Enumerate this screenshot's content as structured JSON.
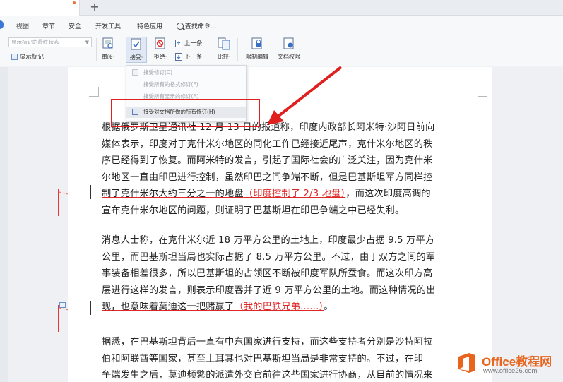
{
  "tabs": {
    "add_label": "+"
  },
  "ribbon": {
    "items": [
      "视图",
      "章节",
      "安全",
      "开发工具",
      "特色应用"
    ],
    "search_label": "查找命令..."
  },
  "toolbar": {
    "markup_select": {
      "value": "显示标记的最终状态"
    },
    "show_markup_label": "显示标记",
    "review_label": "审阅·",
    "accept_label": "接受·",
    "reject_label": "拒绝·",
    "prev_label": "上一条",
    "next_label": "下一条",
    "compare_label": "比较·",
    "restrict_label": "限制编辑",
    "permission_label": "文档权限"
  },
  "dropdown": {
    "items": [
      {
        "label": "接受修订(C)",
        "enabled": false
      },
      {
        "label": "接受所有的格式修订(F)",
        "enabled": false
      },
      {
        "label": "接受所有显示的修订(A)",
        "enabled": false
      },
      {
        "label": "接受对文档所做的所有修订(H)",
        "enabled": true
      }
    ]
  },
  "document": {
    "p1": {
      "l1": "根据俄罗斯卫星通讯社 12 月 13 日的报道称，印度内政部长阿米特·沙阿日前向",
      "l2": "媒体表示，印度对于克什米尔地区的同化工作已经接近尾声，克什米尔地区的秩",
      "l3": "序已经得到了恢复。而阿米特的发言，引起了国际社会的广泛关注，因为克什米",
      "l4": "尔地区一直由印巴进行控制，虽然印巴之间争端不断，但是巴基斯坦军方同样控",
      "l5_a": "制了克什米尔大约三分之一的地盘",
      "l5_ins": "（印度控制了 2/3 地盘）",
      "l5_b": "，而这次印度高调的",
      "l6": "宣布克什米尔地区的问题，则证明了巴基斯坦在印巴争端之中已经失利。"
    },
    "p2": {
      "l1": "消息人士称，在克什米尔近 18 万平方公里的土地上，印度最少占据 9.5 万平方",
      "l2": "公里，而巴基斯坦当局也实际占据了 8.5 万平方公里。不过，由于双方之间的军",
      "l3": "事装备相差很多，所以巴基斯坦的占领区不断被印度军队所蚕食。而这次印方高",
      "l4": "层进行这样的发言，则表示印度吞并了近 9 万平方公里的土地。而这种情况的出",
      "l5_a": "现，也意味着莫迪这一把赌赢了",
      "l5_ins": "（我的巴铁兄弟......）",
      "l5_b": "。"
    },
    "p3": {
      "l1": "据悉，在巴基斯坦背后一直有中东国家进行支持，而这些支持者分别是沙特阿拉",
      "l2": "伯和阿联酋等国家，甚至土耳其也对巴基斯坦当局是非常支持的。不过，在印",
      "l3": "争端发生之后，莫迪频繁的派遣外交官前往这些国家进行协商，从目前的情况来"
    }
  },
  "watermark": {
    "title": "Office教程网",
    "url": "www.office26.com"
  },
  "colors": {
    "revision_red": "#e02727",
    "annotation_red": "#e01f1f",
    "watermark_orange": "#e8651e"
  }
}
